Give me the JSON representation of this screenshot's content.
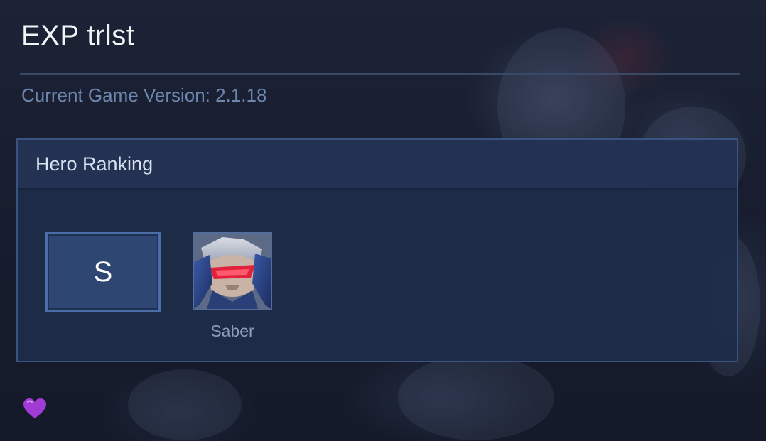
{
  "header": {
    "title": "EXP trlst",
    "version_text": "Current Game Version: 2.1.18"
  },
  "ranking": {
    "panel_title": "Hero Ranking",
    "tiers": [
      {
        "tier": "S",
        "heroes": [
          {
            "name": "Saber",
            "icon": "saber-hero-portrait"
          }
        ]
      }
    ]
  },
  "footer": {
    "icon": "purple-heart-icon"
  },
  "colors": {
    "accent": "#4b6ea8",
    "version_text": "#6d86ad",
    "heart": "#a23ad6"
  }
}
